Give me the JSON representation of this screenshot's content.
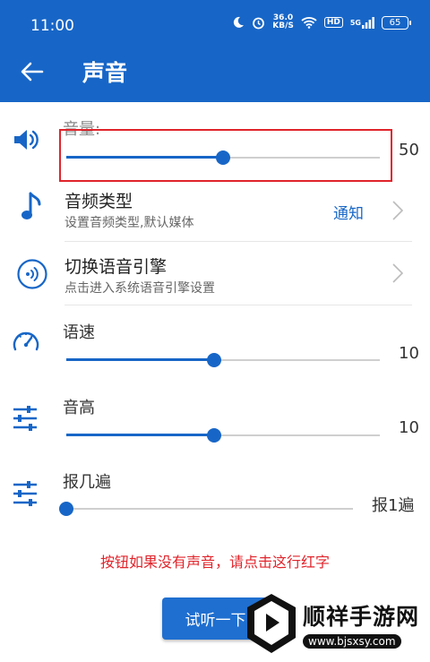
{
  "status_bar": {
    "time": "11:00",
    "speed_value": "36.0",
    "speed_unit": "KB/S",
    "hd": "HD",
    "network": "5G",
    "battery": "65"
  },
  "app_bar": {
    "title": "声音"
  },
  "volume": {
    "label": "音量:",
    "value": "50",
    "level": 0.5
  },
  "audio_type": {
    "title": "音频类型",
    "subtitle": "设置音频类型,默认媒体",
    "value": "通知"
  },
  "engine": {
    "title": "切换语音引擎",
    "subtitle": "点击进入系统语音引擎设置"
  },
  "speed": {
    "label": "语速",
    "value": "10",
    "level": 0.47
  },
  "pitch": {
    "label": "音高",
    "value": "10",
    "level": 0.47
  },
  "report": {
    "label": "报几遍",
    "value": "报1遍",
    "level": 0.0
  },
  "hint_text": "按钮如果没有声音，请点击这行红字",
  "test_button": "试听一下",
  "watermark": {
    "name": "顺祥手游网",
    "url": "www.bjsxsy.com"
  },
  "colors": {
    "primary": "#1766c7",
    "alert": "#e0242b"
  }
}
